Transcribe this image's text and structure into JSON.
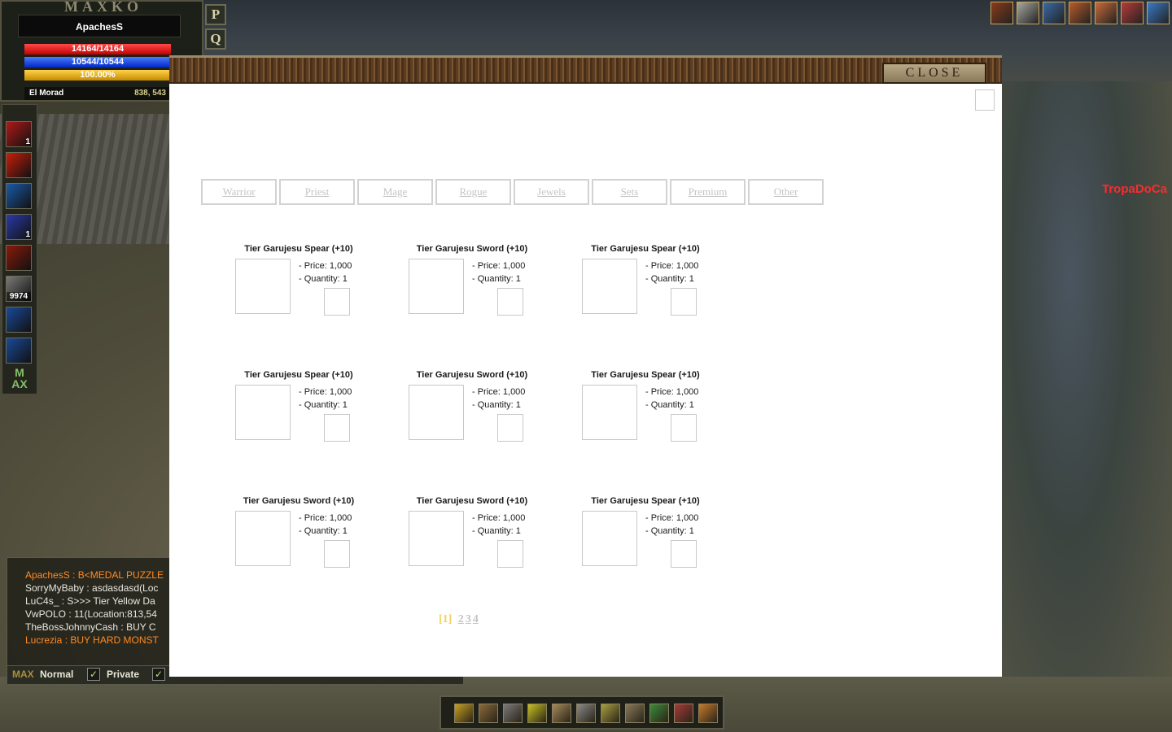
{
  "game": {
    "logo_text": "MAXKO"
  },
  "character": {
    "name": "ApachesS",
    "hp": "14164/14164",
    "mp": "10544/10544",
    "exp": "100.00%",
    "zone": "El Morad",
    "coords": "838, 543"
  },
  "side_buttons": {
    "p": "P",
    "q": "Q"
  },
  "skills": [
    {
      "icon": "red-potion-icon",
      "color": "#b01818",
      "count": "1"
    },
    {
      "icon": "fire-slash-icon",
      "color": "#c81e0a",
      "count": ""
    },
    {
      "icon": "blue-blade-icon",
      "color": "#1a5aa8",
      "count": ""
    },
    {
      "icon": "blue-orb-icon",
      "color": "#2a3aa8",
      "count": "1"
    },
    {
      "icon": "flame-wall-icon",
      "color": "#8a1a0a",
      "count": ""
    },
    {
      "icon": "wolf-icon",
      "color": "#7a7a78",
      "count": "9974"
    },
    {
      "icon": "wind-stride-icon",
      "color": "#1a4a9a",
      "count": ""
    },
    {
      "icon": "wind-stride-icon",
      "color": "#1a4a9a",
      "count": ""
    }
  ],
  "max_logo": "M\nAX",
  "chat": {
    "lines": [
      {
        "text": "ApachesS : B<MEDAL PUZZLE",
        "style": "orange"
      },
      {
        "text": "SorryMyBaby : asdasdasd(Loc",
        "style": "normal"
      },
      {
        "text": "LuC4s_ : S>>> Tier Yellow Da",
        "style": "normal"
      },
      {
        "text": "VwPOLO : 11(Location:813,54",
        "style": "normal"
      },
      {
        "text": "TheBossJohnnyCash : BUY C",
        "style": "normal"
      },
      {
        "text": "Lucrezia : BUY HARD MONST",
        "style": "orange"
      }
    ],
    "tabs": {
      "max": "MAX",
      "normal": "Normal",
      "private": "Private"
    }
  },
  "npc_name": "TropaDoCa",
  "buffs": [
    {
      "icon": "warrior-buff-icon",
      "color": "#8a3a1a"
    },
    {
      "icon": "skull-buff-icon",
      "color": "#a8a8a0"
    },
    {
      "icon": "swirl-buff-icon",
      "color": "#3a6aa8"
    },
    {
      "icon": "fist-buff-icon",
      "color": "#b85a2a"
    },
    {
      "icon": "hand-buff-icon",
      "color": "#c86a3a"
    },
    {
      "icon": "rose-buff-icon",
      "color": "#b83a3a"
    },
    {
      "icon": "sword-buff-icon",
      "color": "#3a7ac8"
    }
  ],
  "store": {
    "close_label": "CLOSE",
    "categories": [
      "Warrior",
      "Priest",
      "Mage",
      "Rogue",
      "Jewels",
      "Sets",
      "Premium",
      "Other"
    ],
    "products": [
      {
        "name": "Tier Garujesu Spear (+10)",
        "price": "- Price: 1,000",
        "quantity": "- Quantity: 1"
      },
      {
        "name": "Tier Garujesu Sword (+10)",
        "price": "- Price: 1,000",
        "quantity": "- Quantity: 1"
      },
      {
        "name": "Tier Garujesu Spear (+10)",
        "price": "- Price: 1,000",
        "quantity": "- Quantity: 1"
      },
      {
        "name": "Tier Garujesu Spear (+10)",
        "price": "- Price: 1,000",
        "quantity": "- Quantity: 1"
      },
      {
        "name": "Tier Garujesu Sword (+10)",
        "price": "- Price: 1,000",
        "quantity": "- Quantity: 1"
      },
      {
        "name": "Tier Garujesu Spear (+10)",
        "price": "- Price: 1,000",
        "quantity": "- Quantity: 1"
      },
      {
        "name": "Tier Garujesu Sword (+10)",
        "price": "- Price: 1,000",
        "quantity": "- Quantity: 1"
      },
      {
        "name": "Tier Garujesu Sword (+10)",
        "price": "- Price: 1,000",
        "quantity": "- Quantity: 1"
      },
      {
        "name": "Tier Garujesu Spear (+10)",
        "price": "- Price: 1,000",
        "quantity": "- Quantity: 1"
      }
    ],
    "pagination": {
      "current": "[1]",
      "pages": [
        "2",
        "3",
        "4"
      ]
    }
  },
  "action_bar": [
    {
      "icon": "m-menu-icon",
      "color": "#c8a020"
    },
    {
      "icon": "inventory-icon",
      "color": "#8a6a3a"
    },
    {
      "icon": "character-icon",
      "color": "#7a7a7a"
    },
    {
      "icon": "skill-icon",
      "color": "#c8c020"
    },
    {
      "icon": "trade-icon",
      "color": "#a88a5a"
    },
    {
      "icon": "party-icon",
      "color": "#8a8a8a"
    },
    {
      "icon": "clan-icon",
      "color": "#a8a040"
    },
    {
      "icon": "options-icon",
      "color": "#8a7a5a"
    },
    {
      "icon": "quest-icon",
      "color": "#3a8a3a"
    },
    {
      "icon": "map-icon",
      "color": "#a83a3a"
    },
    {
      "icon": "settings-icon",
      "color": "#c87a2a"
    }
  ]
}
